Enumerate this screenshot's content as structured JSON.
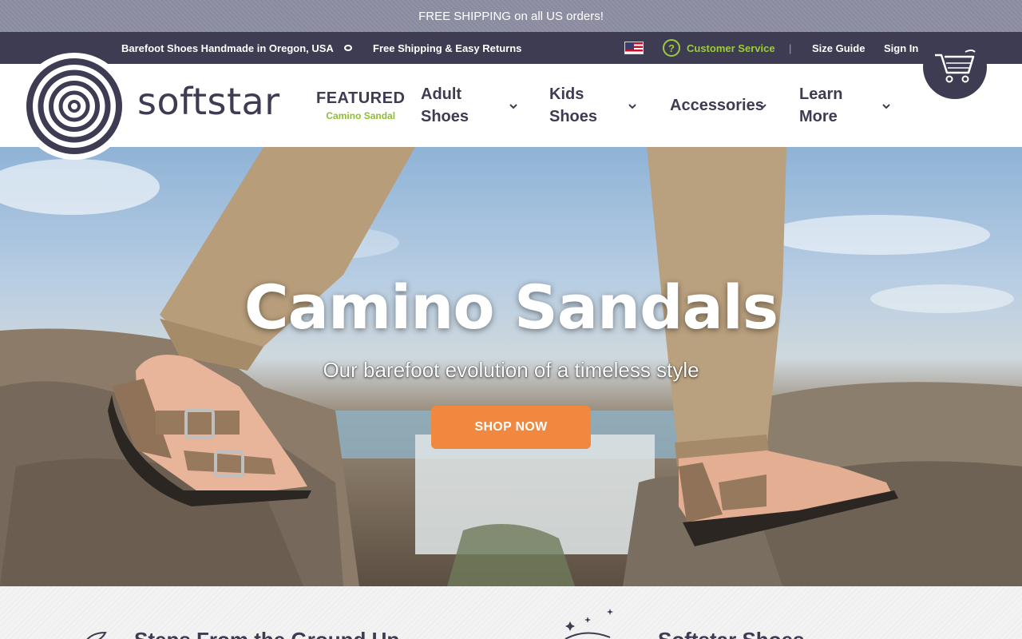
{
  "promo": {
    "text": "FREE SHIPPING on all US orders!"
  },
  "utility": {
    "tagline_left": "Barefoot Shoes Handmade in Oregon, USA",
    "tagline_right": "Free Shipping & Easy Returns",
    "flag_icon": "us-flag-icon",
    "customer_service": "Customer Service",
    "separator": "|",
    "size_guide": "Size Guide",
    "sign_in": "Sign In"
  },
  "brand": {
    "name": "softstar"
  },
  "nav": {
    "featured_label": "FEATURED",
    "featured_item": "Camino Sandal",
    "adult_line1": "Adult",
    "adult_line2": "Shoes",
    "kids_line1": "Kids",
    "kids_line2": "Shoes",
    "accessories": "Accessories",
    "learn_line1": "Learn",
    "learn_line2": "More"
  },
  "hero": {
    "title": "Camino Sandals",
    "subtitle": "Our barefoot evolution of a timeless style",
    "cta": "SHOP NOW"
  },
  "sections": {
    "left_heading": "Steps From the Ground Up",
    "right_heading": "Softstar Shoes"
  },
  "colors": {
    "brand_dark": "#3d3c52",
    "accent_green": "#9bcc3b",
    "cta_orange": "#f0893f",
    "promo_bg": "#8d8ea2"
  }
}
